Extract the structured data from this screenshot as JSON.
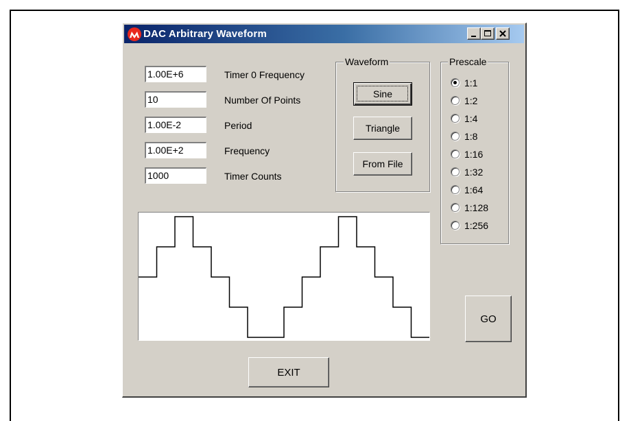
{
  "window": {
    "title": "DAC Arbitrary Waveform",
    "controls": {
      "minimize": "minimize-icon",
      "maximize": "maximize-icon",
      "close": "close-icon"
    }
  },
  "fields": [
    {
      "value": "1.00E+6",
      "label": "Timer 0 Frequency"
    },
    {
      "value": "10",
      "label": "Number Of Points"
    },
    {
      "value": "1.00E-2",
      "label": "Period"
    },
    {
      "value": "1.00E+2",
      "label": "Frequency"
    },
    {
      "value": "1000",
      "label": "Timer Counts"
    }
  ],
  "waveform": {
    "group_label": "Waveform",
    "buttons": [
      "Sine",
      "Triangle",
      "From File"
    ],
    "selected": "Sine"
  },
  "prescale": {
    "group_label": "Prescale",
    "options": [
      "1:1",
      "1:2",
      "1:4",
      "1:8",
      "1:16",
      "1:32",
      "1:64",
      "1:128",
      "1:256"
    ],
    "selected": "1:1"
  },
  "plot": {
    "samples": [
      5,
      6,
      7,
      6,
      5,
      4,
      3,
      3,
      4,
      5,
      6,
      7,
      6,
      5,
      4,
      3
    ],
    "ymin": 3,
    "ymax": 7
  },
  "actions": {
    "go_label": "GO",
    "exit_label": "EXIT"
  },
  "colors": {
    "titlebar_start": "#0a246a",
    "titlebar_end": "#a6caf0",
    "window_bg": "#d4d0c8",
    "logo_red": "#e8281e"
  }
}
